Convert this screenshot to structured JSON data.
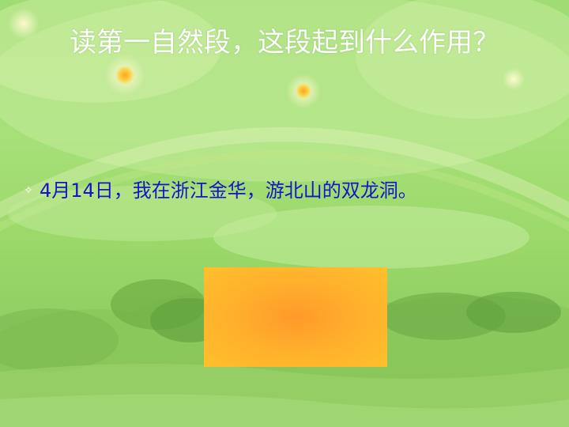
{
  "slide": {
    "title": "读第一自然段，这段起到什么作用？",
    "bullet_marker": "✧",
    "bullet_text": "4月14日，我在浙江金华，游北山的双龙洞。"
  },
  "colors": {
    "background": "#9fdc74",
    "title_text": "#ffffff",
    "bullet_text": "#1414c8",
    "box_center": "#ff9a2a",
    "box_edge": "#ffc02c"
  }
}
